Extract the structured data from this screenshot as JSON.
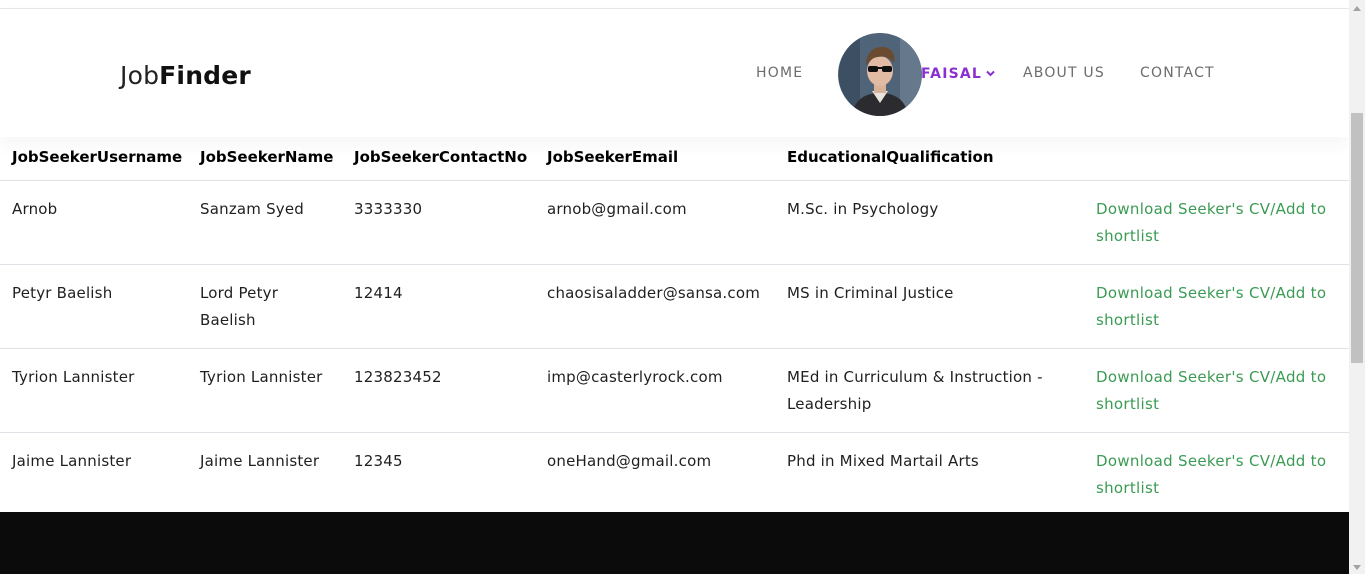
{
  "brand": {
    "logo_light": "Job",
    "logo_bold": "Finder"
  },
  "nav": {
    "home": "HOME",
    "user": "FAISAL",
    "about": "ABOUT US",
    "contact": "CONTACT",
    "user_color": "#8b2fd1",
    "icons": [
      "chevron-down-icon",
      "avatar"
    ]
  },
  "table": {
    "headers": [
      "JobSeekerUsername",
      "JobSeekerName",
      "JobSeekerContactNo",
      "JobSeekerEmail",
      "EducationalQualification",
      ""
    ],
    "action_color": "#3b9b54",
    "rows": [
      {
        "username": "Arnob",
        "name": "Sanzam Syed",
        "contact": "3333330",
        "email": "arnob@gmail.com",
        "qualification": "M.Sc. in Psychology",
        "action": "Download Seeker's CV/Add to shortlist"
      },
      {
        "username": "Petyr Baelish",
        "name": "Lord Petyr Baelish",
        "contact": "12414",
        "email": "chaosisaladder@sansa.com",
        "qualification": "MS in Criminal Justice",
        "action": "Download Seeker's CV/Add to shortlist"
      },
      {
        "username": "Tyrion Lannister",
        "name": "Tyrion Lannister",
        "contact": "123823452",
        "email": "imp@casterlyrock.com",
        "qualification": "MEd in Curriculum & Instruction - Leadership",
        "action": "Download Seeker's CV/Add to shortlist"
      },
      {
        "username": "Jaime Lannister",
        "name": "Jaime Lannister",
        "contact": "12345",
        "email": "oneHand@gmail.com",
        "qualification": "Phd in Mixed Martail Arts",
        "action": "Download Seeker's CV/Add to shortlist"
      }
    ]
  }
}
